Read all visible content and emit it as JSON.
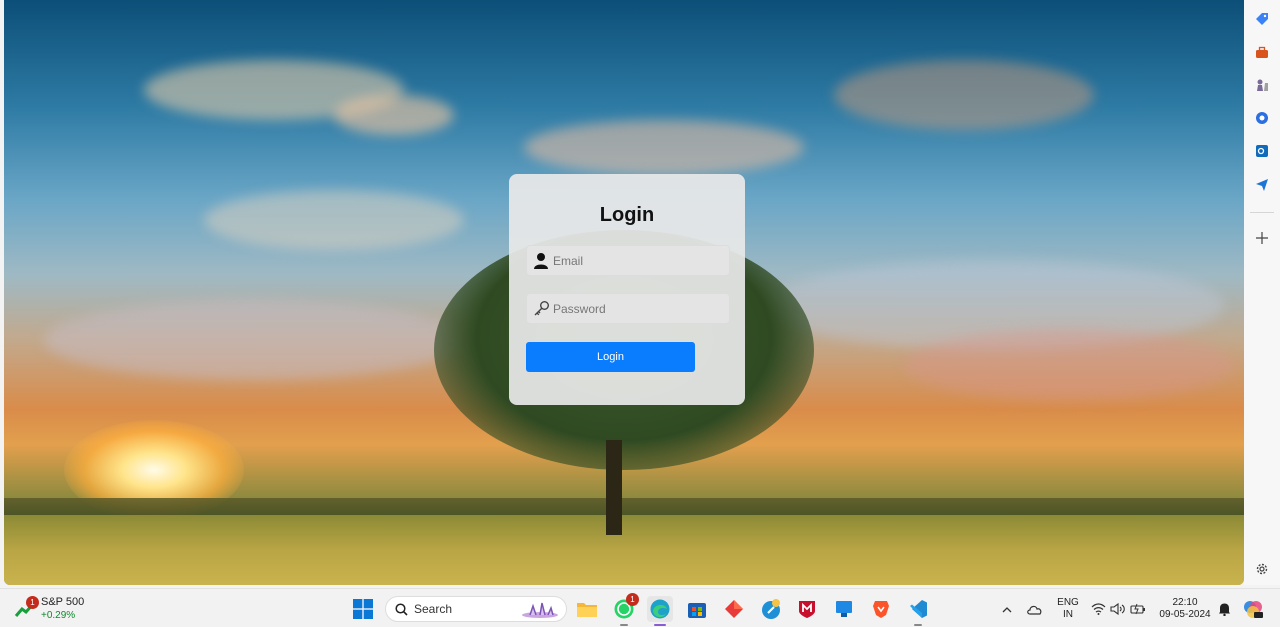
{
  "login": {
    "title": "Login",
    "email_placeholder": "Email",
    "password_placeholder": "Password",
    "button_label": "Login",
    "accent_color": "#0a7dff"
  },
  "edge_sidebar": {
    "items": [
      "tag-icon",
      "toolbox-icon",
      "chess-icon",
      "copilot-icon",
      "outlook-icon",
      "send-icon"
    ],
    "add_icon": "plus-icon",
    "settings_icon": "gear-icon"
  },
  "taskbar": {
    "widget": {
      "badge": "1",
      "name": "S&P 500",
      "change": "+0.29%"
    },
    "search_placeholder": "Search",
    "apps": [
      {
        "icon": "windows-start-icon"
      },
      {
        "icon": "file-explorer-icon"
      },
      {
        "icon": "whatsapp-icon",
        "badge": "1"
      },
      {
        "icon": "edge-browser-icon"
      },
      {
        "icon": "microsoft-store-icon"
      },
      {
        "icon": "red-diamond-app-icon"
      },
      {
        "icon": "skype-like-app-icon"
      },
      {
        "icon": "mcafee-icon"
      },
      {
        "icon": "blue-app-icon"
      },
      {
        "icon": "brave-browser-icon"
      },
      {
        "icon": "vscode-icon"
      }
    ],
    "tray": {
      "language_line1": "ENG",
      "language_line2": "IN",
      "time": "22:10",
      "date": "09-05-2024"
    }
  }
}
